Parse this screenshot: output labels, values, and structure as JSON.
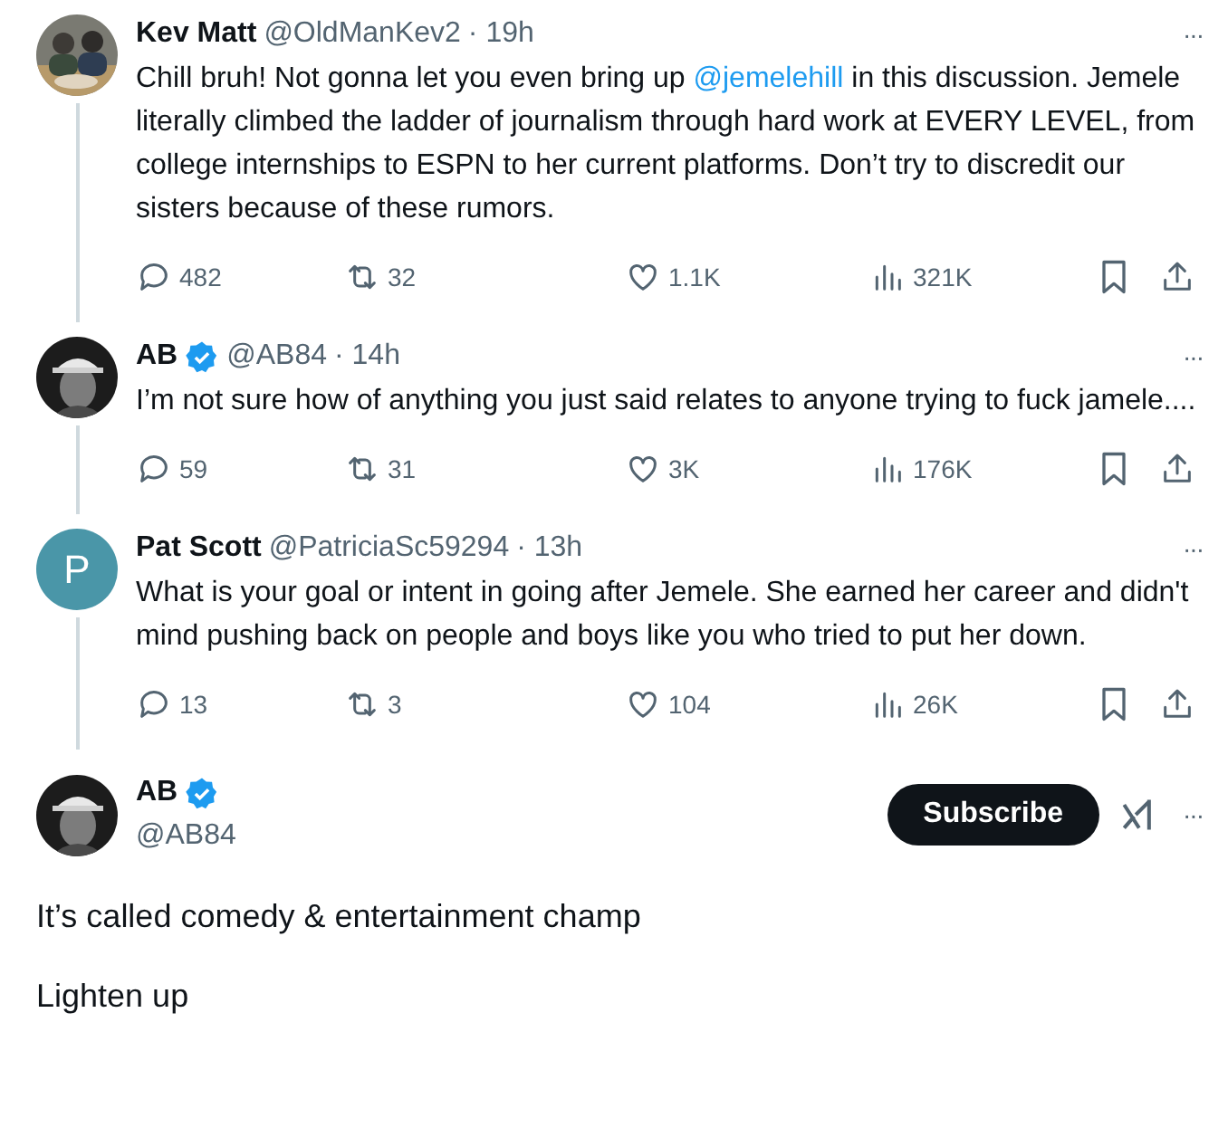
{
  "replies": [
    {
      "avatar": {
        "kind": "picture"
      },
      "name": "Kev Matt",
      "verified": false,
      "handle": "@OldManKev2",
      "time": "· 19h",
      "more": "···",
      "thread_below": true,
      "body": [
        {
          "kind": "text",
          "text": "Chill bruh! Not gonna let you even bring up "
        },
        {
          "kind": "mention",
          "text": "@jemelehill"
        },
        {
          "kind": "text",
          "text": " in this discussion. Jemele literally climbed the ladder of journalism through hard work at EVERY LEVEL, from college internships to ESPN to her current platforms. Don’t try to discredit our sisters because of these rumors."
        }
      ],
      "stats": {
        "replies": "482",
        "reposts": "32",
        "likes": "1.1K",
        "views": "321K"
      }
    },
    {
      "avatar": {
        "kind": "picture"
      },
      "name": "AB",
      "verified": true,
      "handle": "@AB84",
      "time": "· 14h",
      "more": "···",
      "thread_below": true,
      "body": [
        {
          "kind": "text",
          "text": "I’m not sure how of anything you just said relates to anyone trying to fuck jamele...."
        }
      ],
      "stats": {
        "replies": "59",
        "reposts": "31",
        "likes": "3K",
        "views": "176K"
      }
    },
    {
      "avatar": {
        "kind": "initial",
        "initial": "P",
        "color": "#4a96a8"
      },
      "name": "Pat Scott",
      "verified": false,
      "handle": "@PatriciaSc59294",
      "time": "· 13h",
      "more": "···",
      "thread_below": true,
      "body": [
        {
          "kind": "text",
          "text": "What is your goal or intent in going after Jemele. She earned her career and didn't mind pushing back on people and boys like you who tried to put her down."
        }
      ],
      "stats": {
        "replies": "13",
        "reposts": "3",
        "likes": "104",
        "views": "26K"
      }
    }
  ],
  "main_post": {
    "avatar": {
      "kind": "picture"
    },
    "name": "AB",
    "verified": true,
    "handle": "@AB84",
    "subscribe": "Subscribe",
    "more": "···",
    "paragraphs": [
      "It’s called comedy & entertainment champ",
      "Lighten up"
    ]
  }
}
